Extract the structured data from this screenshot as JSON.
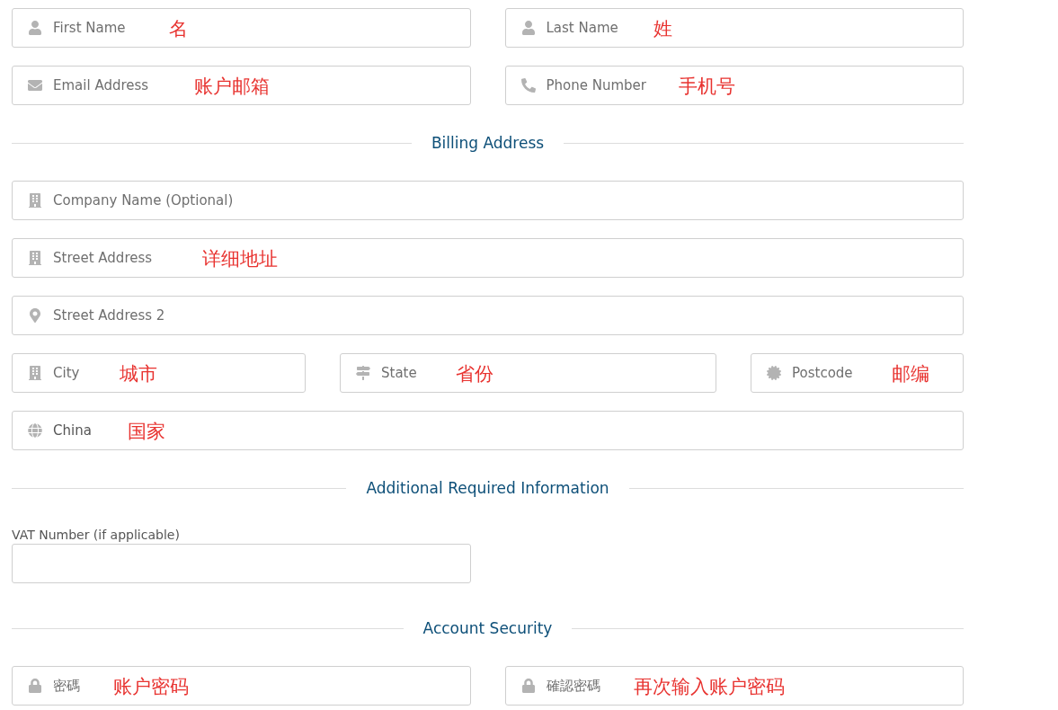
{
  "blocks": [
    {
      "kind": "row",
      "fields": [
        {
          "kind": "person",
          "placeholder": "First Name",
          "note": "名"
        },
        {
          "kind": "person",
          "placeholder": "Last Name",
          "note": "姓"
        }
      ]
    },
    {
      "kind": "row",
      "fields": [
        {
          "kind": "email",
          "placeholder": "Email Address",
          "note": "账户邮箱"
        },
        {
          "kind": "phone",
          "placeholder": "Phone Number",
          "note": "手机号"
        }
      ]
    },
    {
      "kind": "heading",
      "title": "Billing Address"
    },
    {
      "kind": "row",
      "fields": [
        {
          "kind": "building",
          "placeholder": "Company Name (Optional)"
        }
      ]
    },
    {
      "kind": "row",
      "fields": [
        {
          "kind": "building",
          "placeholder": "Street Address",
          "note": "详细地址"
        }
      ]
    },
    {
      "kind": "row",
      "fields": [
        {
          "kind": "pin",
          "placeholder": "Street Address 2"
        }
      ]
    },
    {
      "kind": "row",
      "fields": [
        {
          "kind": "building",
          "placeholder": "City",
          "note": "城市"
        },
        {
          "kind": "signpost",
          "placeholder": "State",
          "note": "省份"
        },
        {
          "kind": "seal",
          "placeholder": "Postcode",
          "note": "邮编"
        }
      ]
    },
    {
      "kind": "row",
      "fields": [
        {
          "kind": "globe",
          "value": "China",
          "note": "国家"
        }
      ]
    },
    {
      "kind": "heading",
      "title": "Additional Required Information"
    },
    {
      "kind": "labelled",
      "label": "VAT Number (if applicable)"
    },
    {
      "kind": "heading",
      "title": "Account Security"
    },
    {
      "kind": "row",
      "fields": [
        {
          "kind": "lock",
          "placeholder": "密碼",
          "note": "账户密码"
        },
        {
          "kind": "lock",
          "placeholder": "確認密碼",
          "note": "再次输入账户密码"
        }
      ]
    }
  ]
}
